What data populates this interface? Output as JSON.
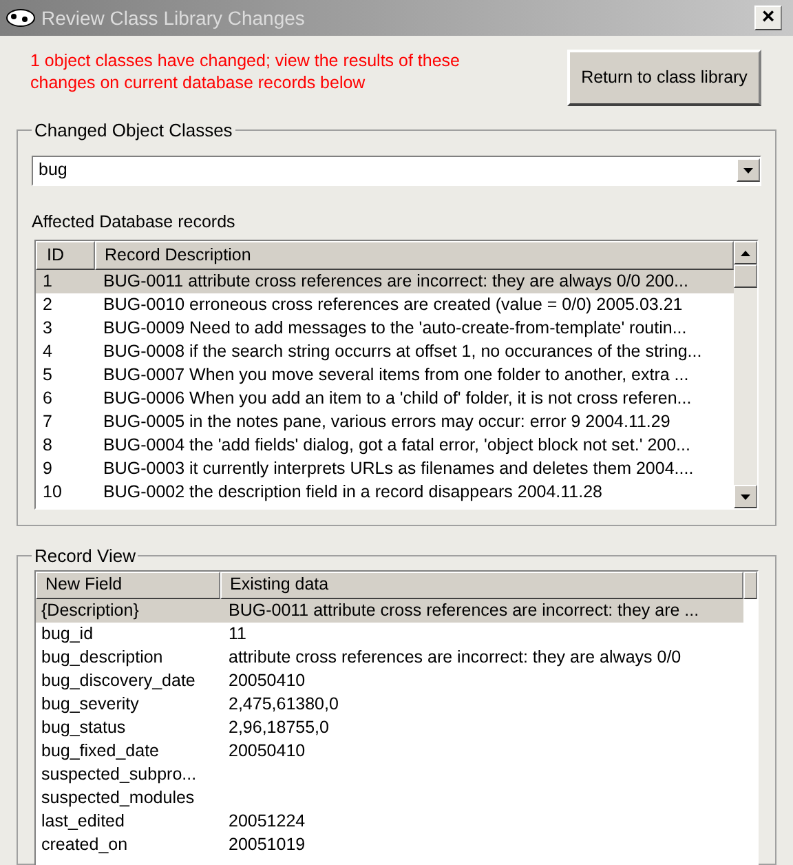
{
  "window": {
    "title": "Review Class Library Changes",
    "close": "×"
  },
  "message": "1 object classes have changed; view the results of these changes on current database records below",
  "return_button": "Return to class library",
  "changed_classes": {
    "legend": "Changed Object Classes",
    "combo_value": "bug",
    "records_label": "Affected Database records",
    "columns": [
      "ID",
      "Record Description"
    ],
    "rows": [
      {
        "id": "1",
        "description": "BUG-0011 attribute cross references are incorrect: they are always 0/0 200...",
        "selected": true
      },
      {
        "id": "2",
        "description": "BUG-0010 erroneous cross references are created (value = 0/0) 2005.03.21",
        "selected": false
      },
      {
        "id": "3",
        "description": "BUG-0009 Need to add messages to the 'auto-create-from-template' routin...",
        "selected": false
      },
      {
        "id": "4",
        "description": "BUG-0008 if the search string occurrs at offset 1, no occurances of the string...",
        "selected": false
      },
      {
        "id": "5",
        "description": "BUG-0007 When you move several items from one folder to another, extra ...",
        "selected": false
      },
      {
        "id": "6",
        "description": "BUG-0006 When you add an item to a 'child of' folder, it is not cross referen...",
        "selected": false
      },
      {
        "id": "7",
        "description": "BUG-0005 in the notes pane, various errors may occur: error 9 2004.11.29",
        "selected": false
      },
      {
        "id": "8",
        "description": "BUG-0004 the 'add fields' dialog, got a fatal error, 'object block not set.' 200...",
        "selected": false
      },
      {
        "id": "9",
        "description": "BUG-0003 it currently interprets URLs as filenames and deletes them 2004....",
        "selected": false
      },
      {
        "id": "10",
        "description": "BUG-0002 the description field in a record disappears 2004.11.28",
        "selected": false
      }
    ]
  },
  "record_view": {
    "legend": "Record View",
    "columns": [
      "New Field",
      "Existing data"
    ],
    "rows": [
      {
        "field": "{Description}",
        "value": "BUG-0011 attribute cross references are incorrect: they are ...",
        "selected": true
      },
      {
        "field": "bug_id",
        "value": "11",
        "selected": false
      },
      {
        "field": "bug_description",
        "value": "attribute cross references are incorrect: they are always 0/0",
        "selected": false
      },
      {
        "field": "bug_discovery_date",
        "value": "20050410",
        "selected": false
      },
      {
        "field": "bug_severity",
        "value": "2,475,61380,0",
        "selected": false
      },
      {
        "field": "bug_status",
        "value": "2,96,18755,0",
        "selected": false
      },
      {
        "field": "bug_fixed_date",
        "value": "20050410",
        "selected": false
      },
      {
        "field": "suspected_subpro...",
        "value": "",
        "selected": false
      },
      {
        "field": "suspected_modules",
        "value": "",
        "selected": false
      },
      {
        "field": "last_edited",
        "value": "20051224",
        "selected": false
      },
      {
        "field": "created_on",
        "value": "20051019",
        "selected": false
      }
    ]
  }
}
